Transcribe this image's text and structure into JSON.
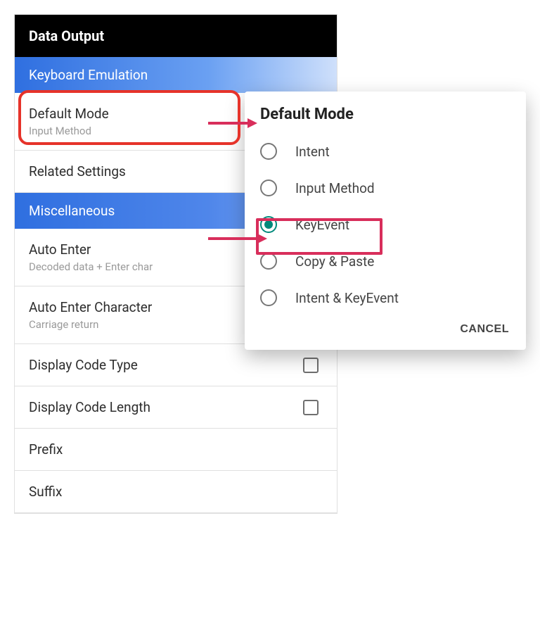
{
  "title": "Data Output",
  "sections": {
    "keyboard_emulation": {
      "header": "Keyboard Emulation",
      "items": {
        "default_mode": {
          "title": "Default Mode",
          "sub": "Input Method"
        },
        "related_settings": {
          "title": "Related Settings"
        }
      }
    },
    "miscellaneous": {
      "header": "Miscellaneous",
      "items": {
        "auto_enter": {
          "title": "Auto Enter",
          "sub": "Decoded data + Enter char"
        },
        "auto_enter_char": {
          "title": "Auto Enter Character",
          "sub": "Carriage return"
        },
        "display_code_type": {
          "title": "Display Code Type"
        },
        "display_code_length": {
          "title": "Display Code Length"
        },
        "prefix": {
          "title": "Prefix"
        },
        "suffix": {
          "title": "Suffix"
        }
      }
    }
  },
  "dialog": {
    "title": "Default Mode",
    "options": {
      "intent": "Intent",
      "input_method": "Input Method",
      "keyevent": "KeyEvent",
      "copy_paste": "Copy & Paste",
      "intent_keyevent": "Intent & KeyEvent"
    },
    "cancel_label": "CANCEL",
    "selected": "keyevent"
  }
}
